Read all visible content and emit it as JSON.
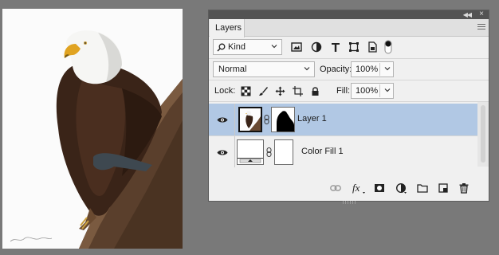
{
  "panel": {
    "tab_label": "Layers",
    "filter": {
      "value": "Kind"
    },
    "blend_mode": {
      "value": "Normal"
    },
    "opacity": {
      "label": "Opacity:",
      "value": "100%"
    },
    "lock": {
      "label": "Lock:"
    },
    "fill": {
      "label": "Fill:",
      "value": "100%"
    },
    "layers": [
      {
        "name": "Layer 1",
        "selected": true,
        "visible": true
      },
      {
        "name": "Color Fill 1",
        "selected": false,
        "visible": true
      }
    ],
    "filter_icons": [
      "image-filter-icon",
      "adjustment-filter-icon",
      "type-filter-icon",
      "shape-filter-icon",
      "smart-object-filter-icon",
      "filter-toggle-icon"
    ],
    "lock_icons": [
      "lock-transparent-icon",
      "lock-image-icon",
      "lock-position-icon",
      "lock-artboard-icon",
      "lock-all-icon"
    ],
    "footer_icons": [
      "link-layers-icon",
      "fx-icon",
      "add-mask-icon",
      "new-adjustment-icon",
      "new-group-icon",
      "new-layer-icon",
      "delete-layer-icon"
    ],
    "colors": {
      "selected_row": "#b1c8e4",
      "panel_bg": "#f0f0f0",
      "workspace": "#797979"
    }
  }
}
